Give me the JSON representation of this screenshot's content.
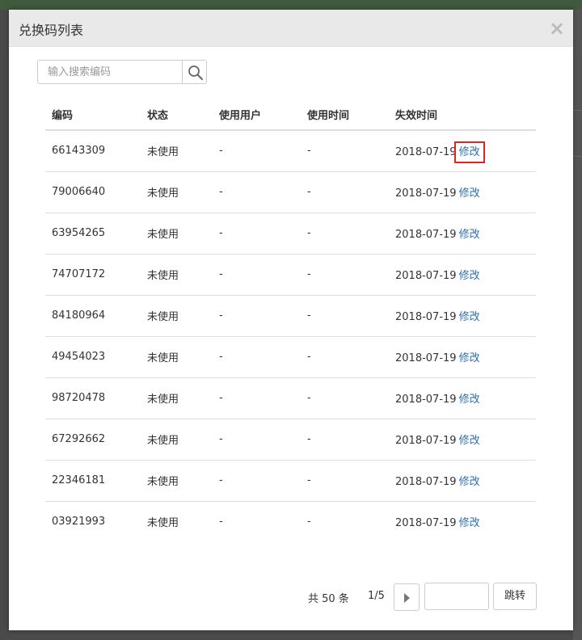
{
  "modal": {
    "title": "兑换码列表",
    "close_symbol": "×"
  },
  "search": {
    "placeholder": "输入搜索编码",
    "value": ""
  },
  "table": {
    "headers": [
      "编码",
      "状态",
      "使用用户",
      "使用时间",
      "失效时间"
    ],
    "rows": [
      {
        "code": "66143309",
        "status": "未使用",
        "user": "-",
        "used_at": "-",
        "expires": "2018-07-19",
        "action": "修改"
      },
      {
        "code": "79006640",
        "status": "未使用",
        "user": "-",
        "used_at": "-",
        "expires": "2018-07-19",
        "action": "修改"
      },
      {
        "code": "63954265",
        "status": "未使用",
        "user": "-",
        "used_at": "-",
        "expires": "2018-07-19",
        "action": "修改"
      },
      {
        "code": "74707172",
        "status": "未使用",
        "user": "-",
        "used_at": "-",
        "expires": "2018-07-19",
        "action": "修改"
      },
      {
        "code": "84180964",
        "status": "未使用",
        "user": "-",
        "used_at": "-",
        "expires": "2018-07-19",
        "action": "修改"
      },
      {
        "code": "49454023",
        "status": "未使用",
        "user": "-",
        "used_at": "-",
        "expires": "2018-07-19",
        "action": "修改"
      },
      {
        "code": "98720478",
        "status": "未使用",
        "user": "-",
        "used_at": "-",
        "expires": "2018-07-19",
        "action": "修改"
      },
      {
        "code": "67292662",
        "status": "未使用",
        "user": "-",
        "used_at": "-",
        "expires": "2018-07-19",
        "action": "修改"
      },
      {
        "code": "22346181",
        "status": "未使用",
        "user": "-",
        "used_at": "-",
        "expires": "2018-07-19",
        "action": "修改"
      },
      {
        "code": "03921993",
        "status": "未使用",
        "user": "-",
        "used_at": "-",
        "expires": "2018-07-19",
        "action": "修改"
      }
    ]
  },
  "pagination": {
    "total_text": "共 50 条",
    "page_indicator": "1/5",
    "jump_input_value": "",
    "jump_label": "跳转"
  },
  "colors": {
    "link": "#2a6fb0",
    "highlight_box": "#e0261f",
    "header_bg": "#e9e9e9"
  },
  "icons": {
    "search": "search-icon",
    "next": "next-page-icon",
    "close": "close-icon"
  }
}
